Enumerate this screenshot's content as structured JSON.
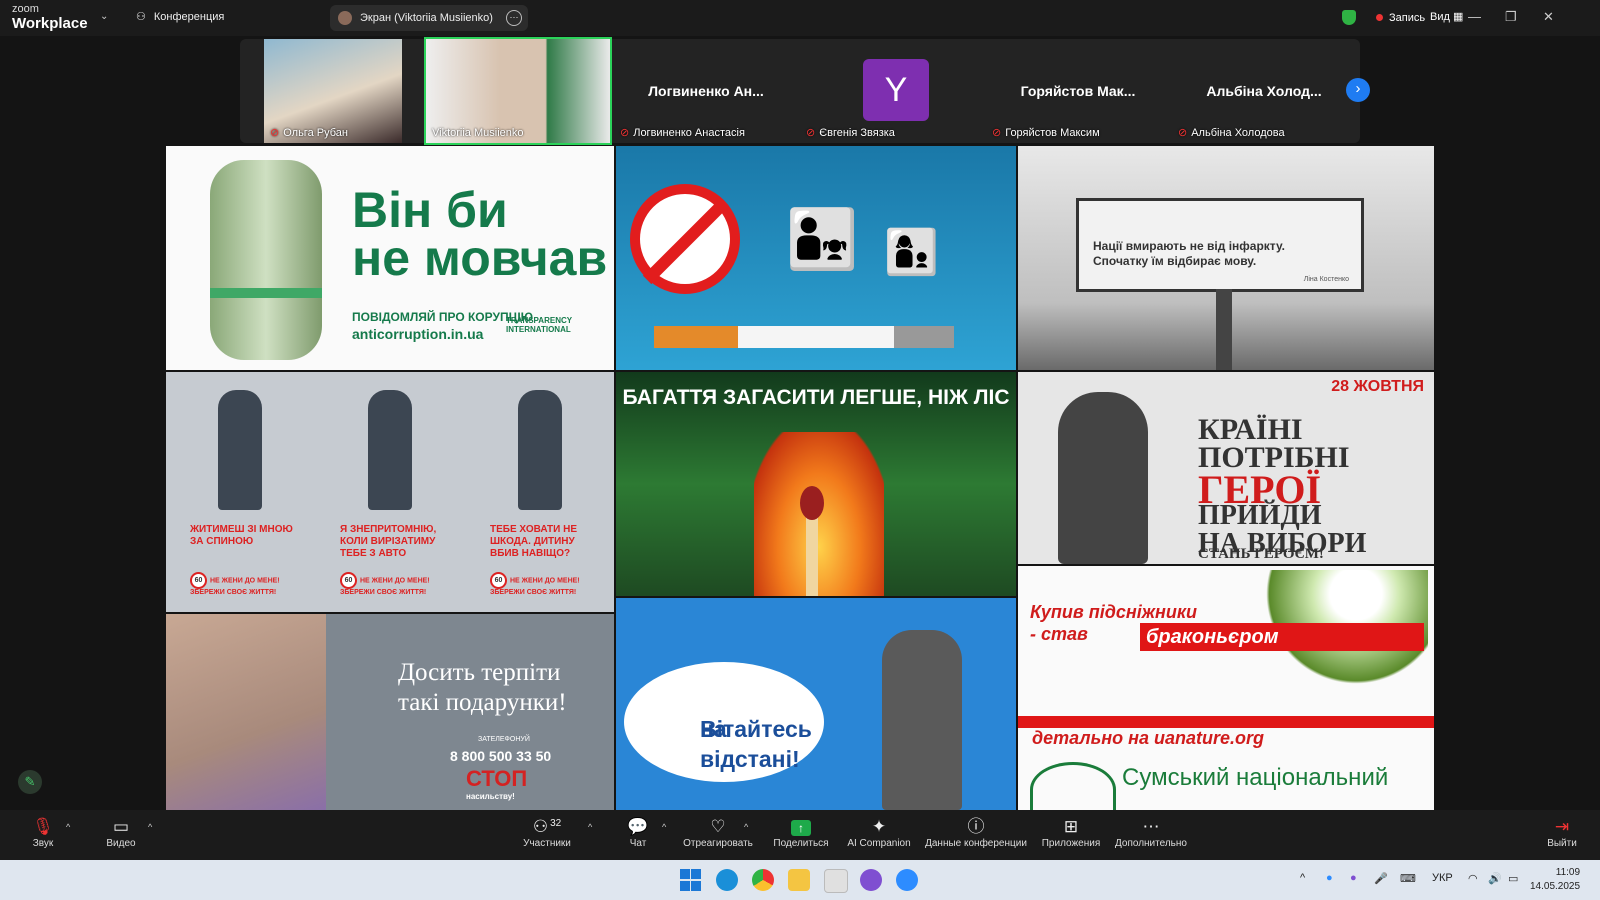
{
  "app": {
    "logo_top": "zoom",
    "logo_bottom": "Workplace",
    "conference_label": "Конференция",
    "screen_share_label": "Экран (Viktoriia Musiienko)",
    "record_label": "Запись",
    "view_label": "Вид"
  },
  "participants": [
    {
      "name": "Ольга Рубан",
      "type": "video"
    },
    {
      "name": "Viktoriia Musiienko",
      "type": "video",
      "active": true
    },
    {
      "name": "Логвиненко Анастасія",
      "display": "Логвиненко Ан...",
      "type": "name"
    },
    {
      "name": "Євгенія Звязка",
      "display": "Y",
      "type": "avatar",
      "color": "#7e2fb0"
    },
    {
      "name": "Горяйстов Максим",
      "display": "Горяйстов Мак...",
      "type": "name"
    },
    {
      "name": "Альбіна Холодова",
      "display": "Альбіна Холод...",
      "type": "name"
    }
  ],
  "posters": {
    "p1": {
      "headline_1": "Він би",
      "headline_2": "не мовчав",
      "sub": "ПОВІДОМЛЯЙ ПРО КОРУПЦІЮ",
      "site": "anticorruption.in.ua",
      "org": "TRANSPARENCY INTERNATIONAL"
    },
    "p3": {
      "line_1": "Нації вмирають не від інфаркту.",
      "line_2": "Спочатку їм відбирає мову.",
      "author": "Ліна Костенко"
    },
    "p4": [
      {
        "text": "ЖИТИМЕШ ЗІ МНОЮ ЗА СПИНОЮ",
        "foot": "НЕ ЖЕНИ ДО МЕНЕ! ЗБЕРЕЖИ СВОЄ ЖИТТЯ!"
      },
      {
        "text": "Я ЗНЕПРИТОМНІЮ, КОЛИ ВИРІЗАТИМУ ТЕБЕ З АВТО",
        "foot": "НЕ ЖЕНИ ДО МЕНЕ! ЗБЕРЕЖИ СВОЄ ЖИТТЯ!"
      },
      {
        "text": "ТЕБЕ ХОВАТИ НЕ ШКОДА. ДИТИНУ ВБИВ НАВІЩО?",
        "foot": "НЕ ЖЕНИ ДО МЕНЕ! ЗБЕРЕЖИ СВОЄ ЖИТТЯ!"
      }
    ],
    "p4_sign": "60",
    "p5": {
      "headline": "БАГАТТЯ ЗАГАСИТИ ЛЕГШЕ, НІЖ ЛІС"
    },
    "p6": {
      "date": "28 ЖОВТНЯ",
      "line_1": "КРАЇНІ",
      "line_2": "ПОТРІБНІ",
      "line_3": "ГЕРОЇ",
      "line_4": "ПРИЙДИ",
      "line_5": "НА ВИБОРИ",
      "line_6": "СТАНЬ ГЕРОЄМ!"
    },
    "p7": {
      "line_1": "Досить терпіти",
      "line_2": "такі подарунки!",
      "small": "ЗАТЕЛЕФОНУЙ",
      "phone": "8 800 500 33 50",
      "stop": "СТОП",
      "sub": "насильству!"
    },
    "p8": {
      "line_1": "Вітайтесь",
      "line_2": "на відстані!"
    },
    "p9": {
      "line_1": "Купив підсніжники",
      "line_2": "- став",
      "box": "браконьєром",
      "line_3": "детально на uanature.org",
      "line_4": "Сумський національний"
    }
  },
  "toolbar": {
    "sound": "Звук",
    "video": "Видео",
    "participants": "Участники",
    "participants_count": "32",
    "chat": "Чат",
    "react": "Отреагировать",
    "share": "Поделиться",
    "companion": "AI Companion",
    "info": "Данные конференции",
    "apps": "Приложения",
    "more": "Дополнительно",
    "leave": "Выйти"
  },
  "taskbar": {
    "lang": "УКР",
    "time": "11:09",
    "date": "14.05.2025"
  }
}
